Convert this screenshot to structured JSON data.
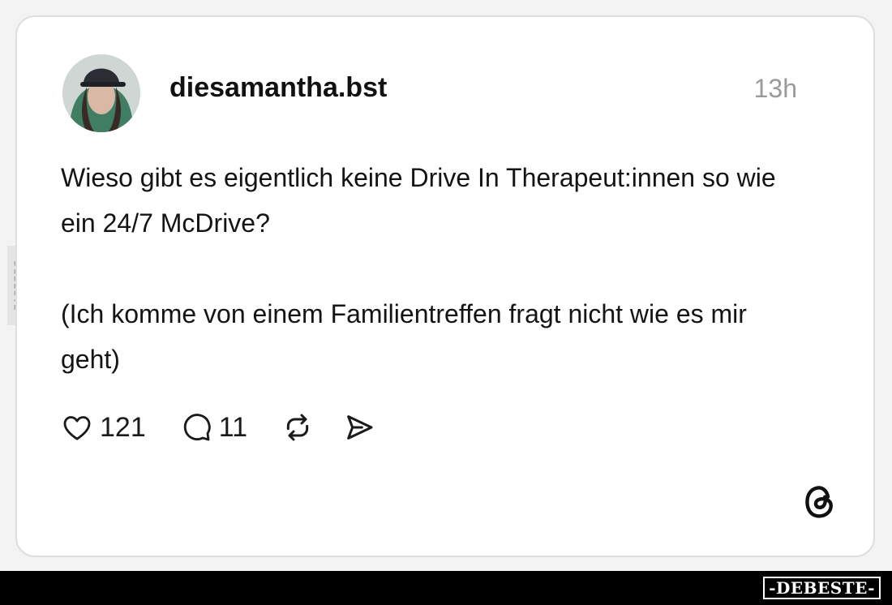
{
  "watermark": {
    "side": "DEBESTE",
    "brand": "-DEBESTE-"
  },
  "post": {
    "username": "diesamantha.bst",
    "time": "13h",
    "text": [
      "Wieso gibt es eigentlich keine Drive In Therapeut:innen so wie ein 24/7 McDrive?",
      "(Ich komme von einem Familientreffen fragt nicht wie es mir geht)"
    ]
  },
  "actions": {
    "like_count": "121",
    "reply_count": "11",
    "icons": [
      "heart-icon",
      "comment-icon",
      "repost-icon",
      "share-icon"
    ]
  },
  "app_icon": "threads-logo-icon",
  "colors": {
    "card_bg": "#ffffff",
    "page_bg": "#f3f3f3",
    "text": "#141414",
    "muted": "#9a9a9a",
    "bar": "#000000"
  }
}
